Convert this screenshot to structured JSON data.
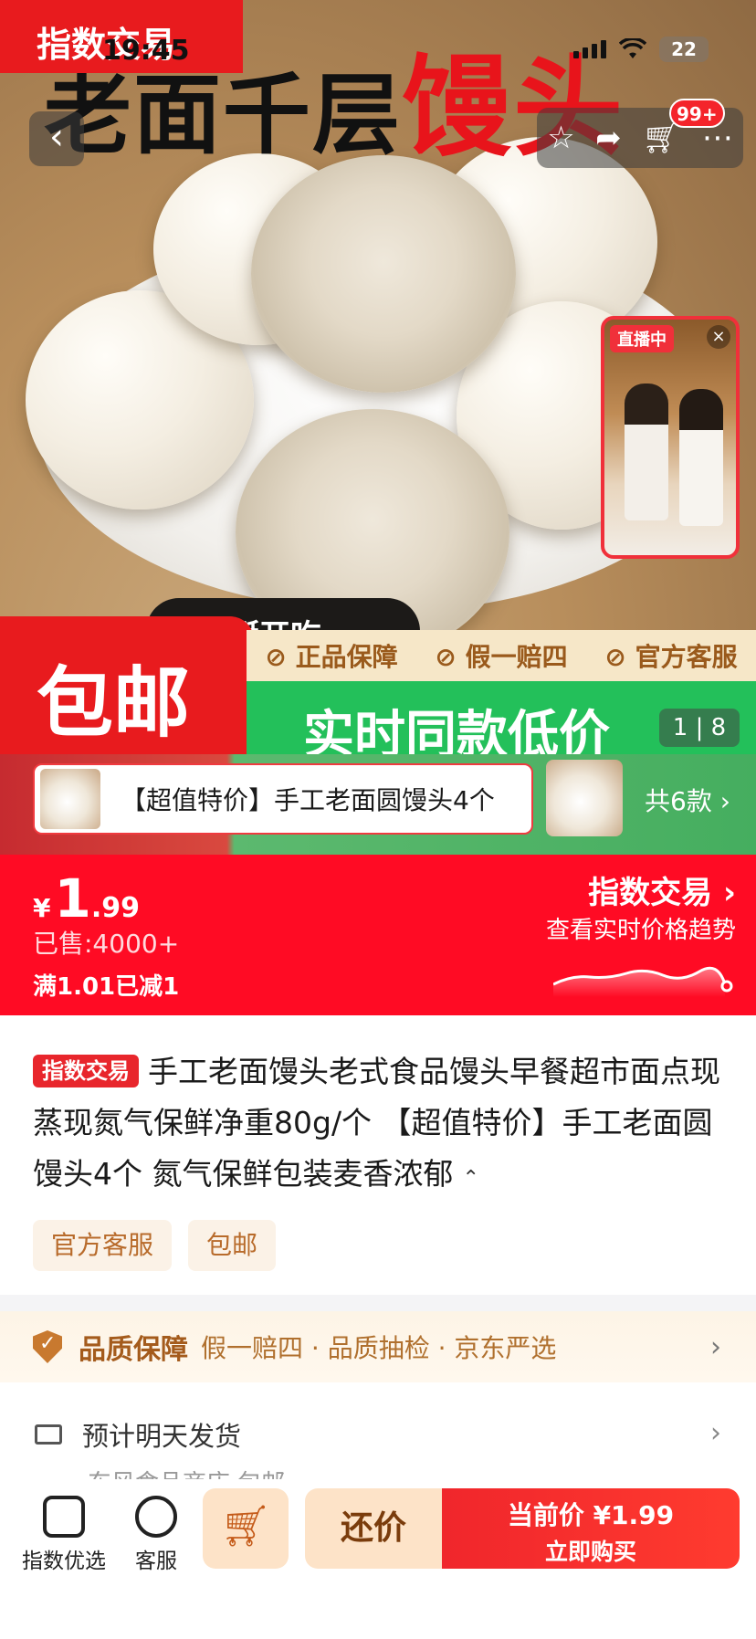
{
  "status_bar": {
    "time": "19:45",
    "battery": "22"
  },
  "hero": {
    "index_badge": "指数交易",
    "title_black": "老面千层",
    "title_red": "馒头",
    "subtitle": "掰开吃"
  },
  "nav": {
    "back_icon": "chevron-left",
    "cart_badge": "99+"
  },
  "live": {
    "tag": "直播中",
    "close": "×"
  },
  "promo": {
    "baoyou": "包邮",
    "guarantees": [
      "正品保障",
      "假一赔四",
      "官方客服"
    ],
    "low_price": "实时同款低价",
    "page_current": "1",
    "page_total": "8"
  },
  "sku": {
    "selected": "【超值特价】手工老面圆馒头4个",
    "count_label": "共6款"
  },
  "price": {
    "currency": "¥",
    "integer": "1",
    "decimal": ".99",
    "sold": "已售:4000+",
    "promotion": "满1.01已减1",
    "index_title": "指数交易",
    "index_sub": "查看实时价格趋势"
  },
  "product": {
    "tag": "指数交易",
    "title": "手工老面馒头老式食品馒头早餐超市面点现蒸现氮气保鲜净重80g/个 【超值特价】手工老面圆馒头4个 氮气保鲜包装麦香浓郁",
    "chips": [
      "官方客服",
      "包邮"
    ]
  },
  "quality": {
    "title": "品质保障",
    "items": "假一赔四 · 品质抽检 · 京东严选"
  },
  "shipping": {
    "text": "预计明天发货",
    "sub": "东风食品商店 包邮"
  },
  "bottom_bar": {
    "shop": "指数优选",
    "service": "客服",
    "haggle": "还价",
    "buy_line1": "当前价 ¥1.99",
    "buy_line2": "立即购买"
  },
  "colors": {
    "brand_red": "#ff0b24",
    "promo_green": "#23c05a",
    "quality_brown": "#a45b1c"
  }
}
